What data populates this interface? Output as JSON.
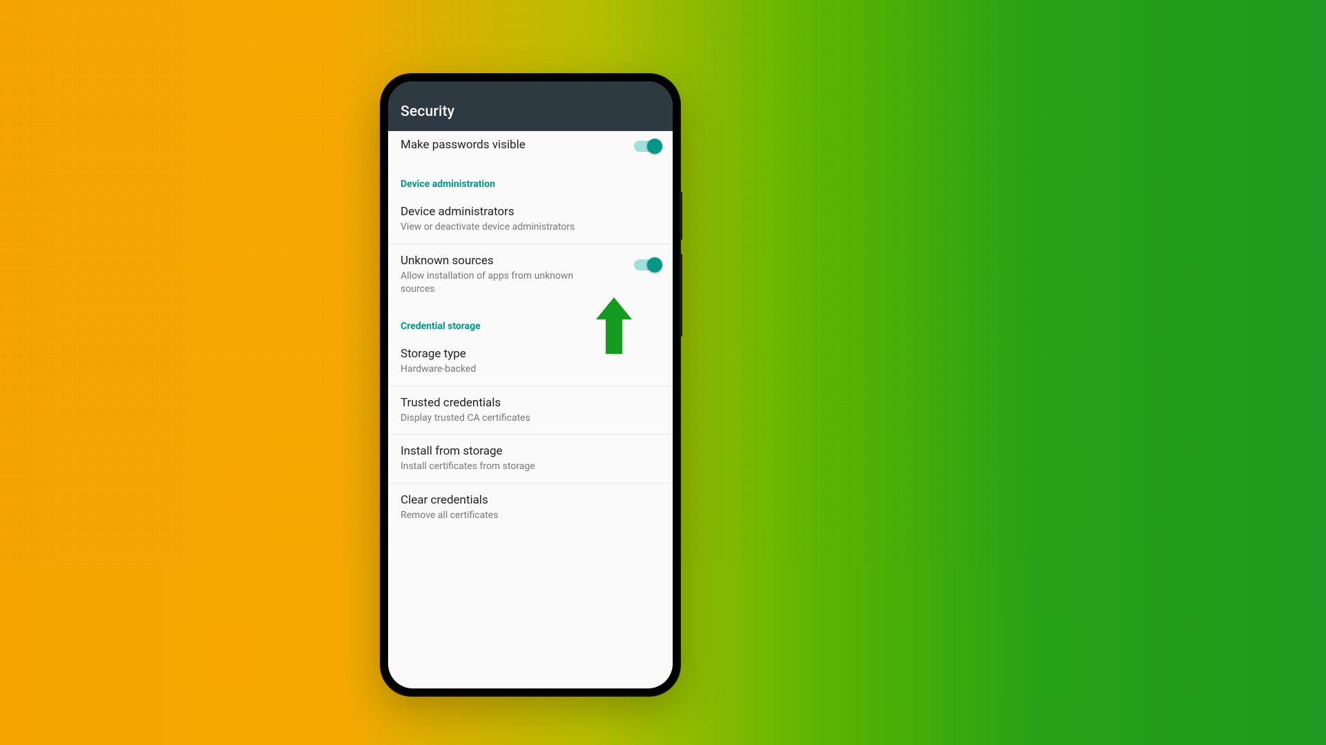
{
  "appbar": {
    "title": "Security"
  },
  "rows": {
    "make_passwords_visible": {
      "title": "Make passwords visible"
    },
    "device_administrators": {
      "title": "Device administrators",
      "sub": "View or deactivate device administrators"
    },
    "unknown_sources": {
      "title": "Unknown sources",
      "sub": "Allow installation of apps from unknown sources"
    },
    "storage_type": {
      "title": "Storage type",
      "sub": "Hardware-backed"
    },
    "trusted_credentials": {
      "title": "Trusted credentials",
      "sub": "Display trusted CA certificates"
    },
    "install_from_storage": {
      "title": "Install from storage",
      "sub": "Install certificates from storage"
    },
    "clear_credentials": {
      "title": "Clear credentials",
      "sub": "Remove all certificates"
    }
  },
  "sections": {
    "device_administration": "Device administration",
    "credential_storage": "Credential storage"
  },
  "colors": {
    "accent": "#009688",
    "arrow": "#159b1f"
  }
}
